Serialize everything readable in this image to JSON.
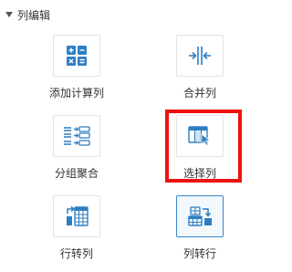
{
  "section": {
    "title": "列编辑",
    "expanded": true
  },
  "tiles": [
    {
      "label": "添加计算列",
      "icon": "calculator-icon"
    },
    {
      "label": "合并列",
      "icon": "merge-columns-icon"
    },
    {
      "label": "分组聚合",
      "icon": "group-aggregate-icon"
    },
    {
      "label": "选择列",
      "icon": "select-columns-icon",
      "highlighted": true
    },
    {
      "label": "行转列",
      "icon": "row-to-column-icon"
    },
    {
      "label": "列转行",
      "icon": "column-to-row-icon",
      "selected": true
    }
  ],
  "colors": {
    "accent": "#2e7fc2",
    "highlight": "#ee1111"
  }
}
